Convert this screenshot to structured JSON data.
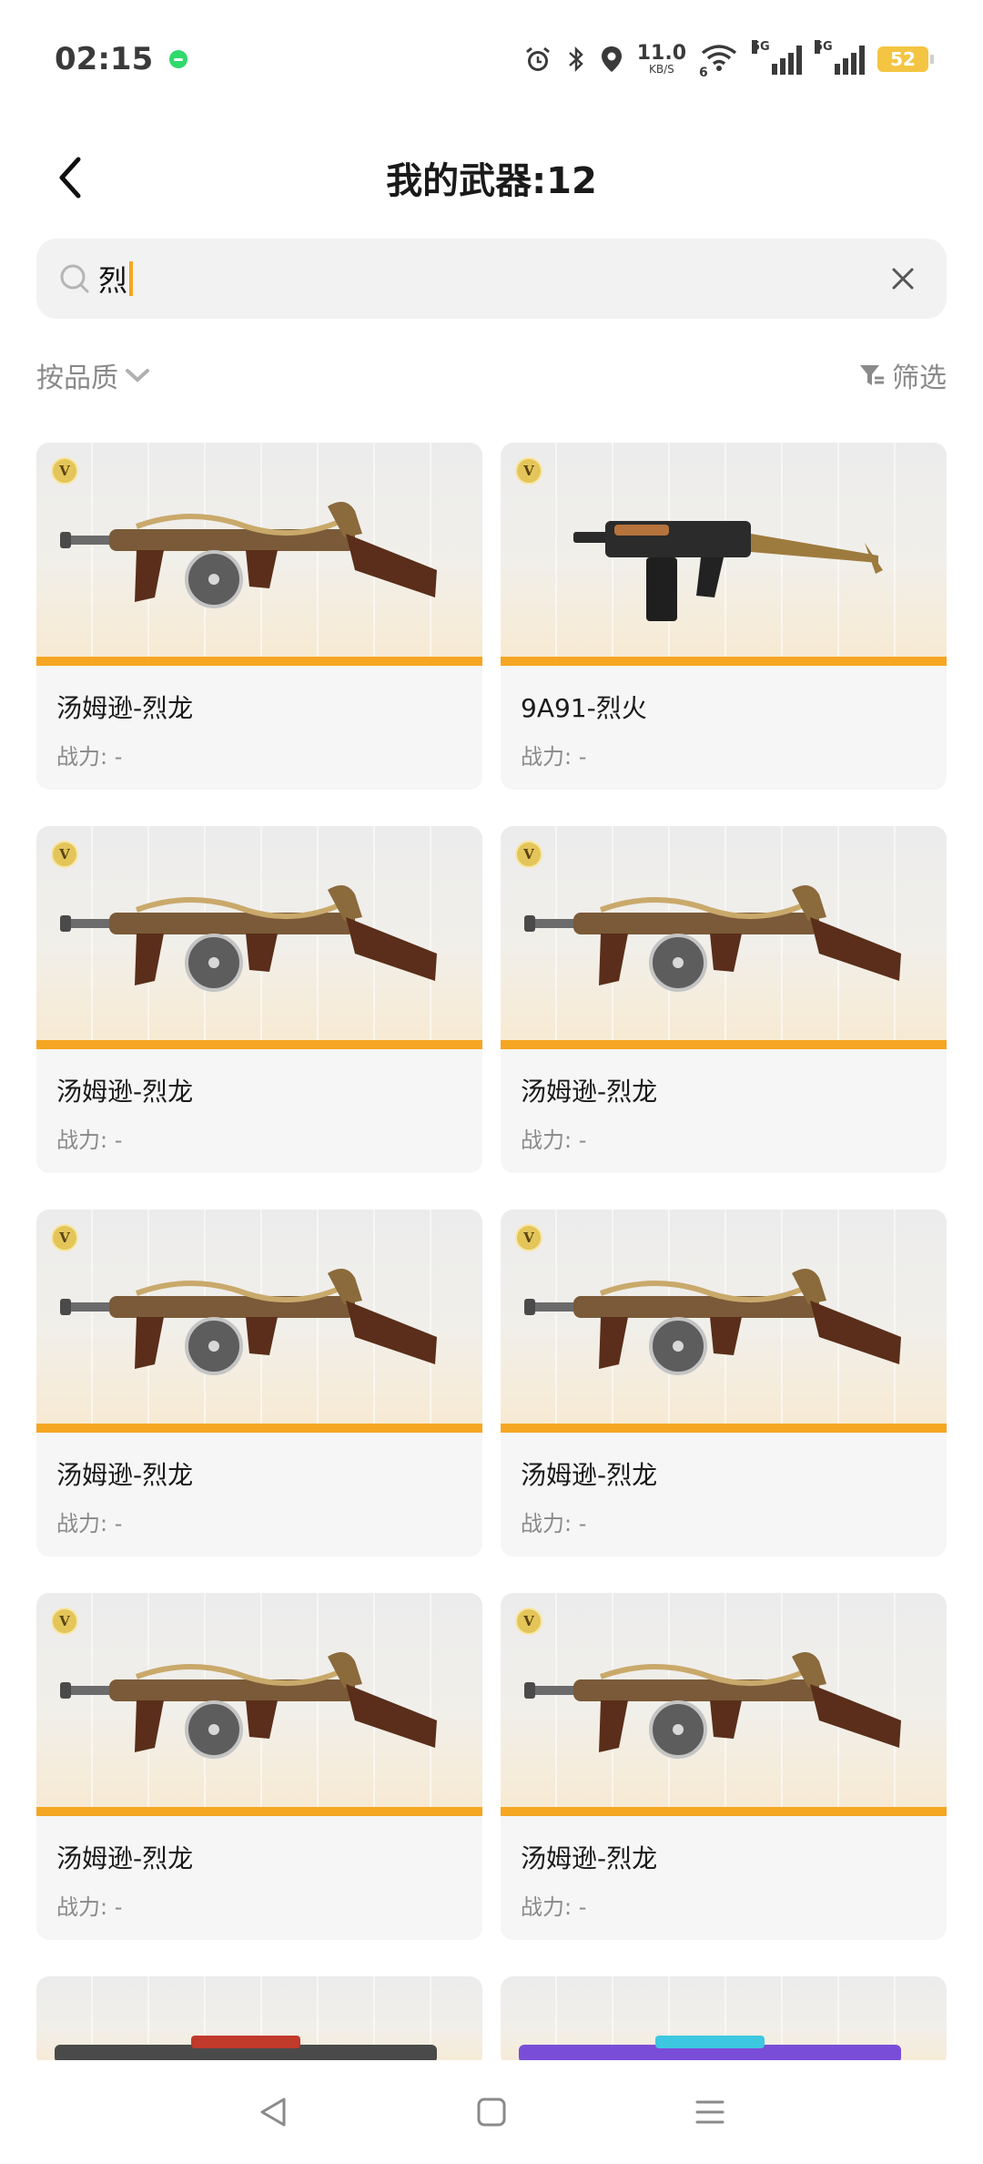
{
  "status_bar": {
    "time": "02:15",
    "net_speed_value": "11.0",
    "net_speed_unit": "KB/S",
    "wifi_badge": "6",
    "sim1_label": "5G",
    "sim2_label": "5G",
    "battery": "52"
  },
  "header": {
    "title": "我的武器:12"
  },
  "search": {
    "value": "烈"
  },
  "filters": {
    "sort_label": "按品质",
    "filter_label": "筛选"
  },
  "cards": [
    {
      "name": "汤姆逊-烈龙",
      "power": "战力: -",
      "gun": "tommy"
    },
    {
      "name": "9A91-烈火",
      "power": "战力: -",
      "gun": "smg"
    },
    {
      "name": "汤姆逊-烈龙",
      "power": "战力: -",
      "gun": "tommy"
    },
    {
      "name": "汤姆逊-烈龙",
      "power": "战力: -",
      "gun": "tommy"
    },
    {
      "name": "汤姆逊-烈龙",
      "power": "战力: -",
      "gun": "tommy"
    },
    {
      "name": "汤姆逊-烈龙",
      "power": "战力: -",
      "gun": "tommy"
    },
    {
      "name": "汤姆逊-烈龙",
      "power": "战力: -",
      "gun": "tommy"
    },
    {
      "name": "汤姆逊-烈龙",
      "power": "战力: -",
      "gun": "tommy"
    }
  ],
  "badge_letter": "V",
  "colors": {
    "accent": "#f5a623",
    "muted": "#8a8a8a"
  }
}
